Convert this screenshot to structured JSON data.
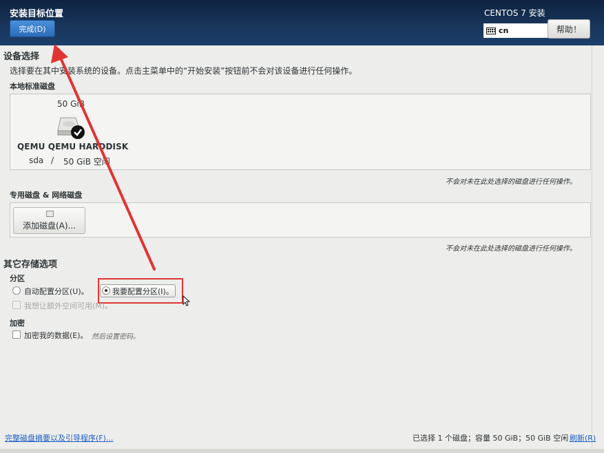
{
  "header": {
    "title": "安装目标位置",
    "done_label": "完成(D)",
    "product": "CENTOS 7 安装",
    "keyboard_layout": "cn",
    "help_label": "帮助！"
  },
  "device_selection": {
    "heading": "设备选择",
    "description": "选择要在其中安装系统的设备。点击主菜单中的“开始安装”按钮前不会对该设备进行任何操作。",
    "local_disks_heading": "本地标准磁盘",
    "disk": {
      "size": "50 GiB",
      "name": "QEMU QEMU HARDDISK",
      "device": "sda",
      "separator": "/",
      "free": "50 GiB 空闲"
    },
    "local_note": "不会对未在此处选择的磁盘进行任何操作。",
    "specialized_heading": "专用磁盘 & 网络磁盘",
    "add_disk_label": "添加磁盘(A)...",
    "specialized_note": "不会对未在此处选择的磁盘进行任何操作。"
  },
  "other_options": {
    "heading": "其它存储选项",
    "partitioning_heading": "分区",
    "auto_partition_label": "自动配置分区(U)。",
    "manual_partition_label": "我要配置分区(I)。",
    "extra_space_label": "我想让额外空间可用(M)。",
    "encryption_heading": "加密",
    "encrypt_label": "加密我的数据(E)。",
    "encrypt_hint": "然后设置密码。"
  },
  "footer": {
    "summary_link": "完整磁盘摘要以及引导程序(F)...",
    "status": "已选择 1 个磁盘；容量 50 GiB；50 GiB 空闲",
    "refresh_link": "刷新(R)"
  },
  "colors": {
    "header_bg": "#18365c",
    "accent_blue": "#2b6cb8",
    "annotation_red": "#e03434"
  }
}
